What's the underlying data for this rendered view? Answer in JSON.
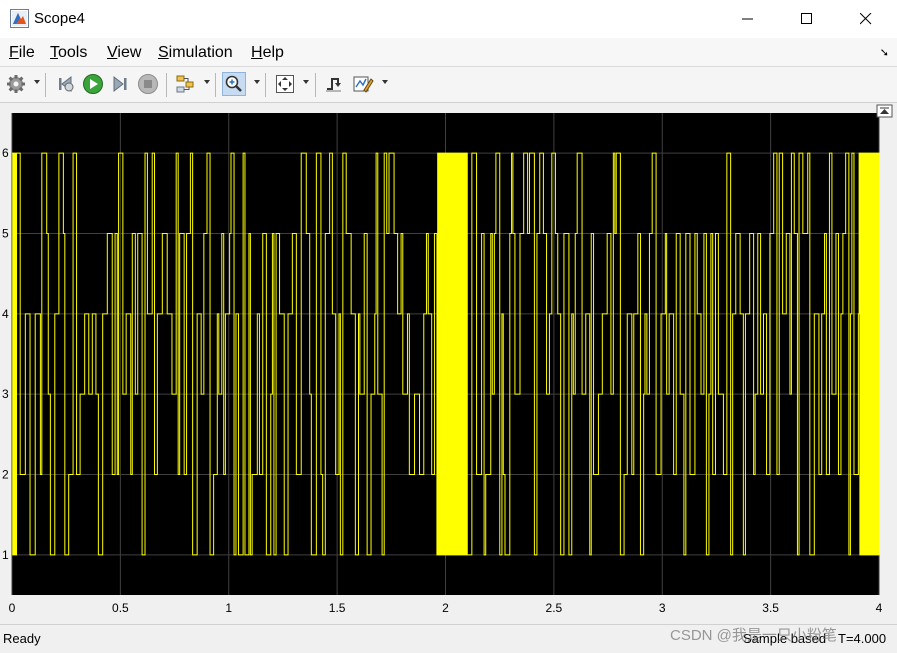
{
  "window": {
    "title": "Scope4"
  },
  "menu": {
    "items": [
      {
        "label_u": "F",
        "label_rest": "ile"
      },
      {
        "label_u": "T",
        "label_rest": "ools"
      },
      {
        "label_u": "V",
        "label_rest": "iew"
      },
      {
        "label_u": "S",
        "label_rest": "imulation"
      },
      {
        "label_u": "H",
        "label_rest": "elp"
      }
    ],
    "overflow_arrow": "➘"
  },
  "toolbar": {
    "icons": [
      "gear-icon",
      "step-back-icon",
      "run-icon",
      "step-forward-icon",
      "stop-icon",
      "highlight-icon",
      "zoom-in-icon",
      "fit-to-view-icon",
      "trigger-icon",
      "cursor-measure-icon"
    ]
  },
  "status": {
    "left": "Ready",
    "mode": "Sample based",
    "time": "T=4.000"
  },
  "watermark": "CSDN @我是一只小粉笔",
  "colors": {
    "plot_bg": "#000000",
    "signal": "#ffff00",
    "grid": "#404040",
    "window_bg": "#f0f0f0"
  },
  "chart_data": {
    "type": "line",
    "title": "",
    "xlabel": "",
    "ylabel": "",
    "xlim": [
      0,
      4
    ],
    "ylim": [
      0.5,
      6.5
    ],
    "x_ticks": [
      "0",
      "0.5",
      "1",
      "1.5",
      "2",
      "2.5",
      "3",
      "3.5",
      "4"
    ],
    "y_ticks": [
      "1",
      "2",
      "3",
      "4",
      "5",
      "6"
    ],
    "grid": true,
    "series": [
      {
        "description_free": true,
        "x_range": [
          0,
          4
        ],
        "levels": [
          1,
          2,
          3,
          4,
          5,
          6
        ]
      }
    ]
  }
}
